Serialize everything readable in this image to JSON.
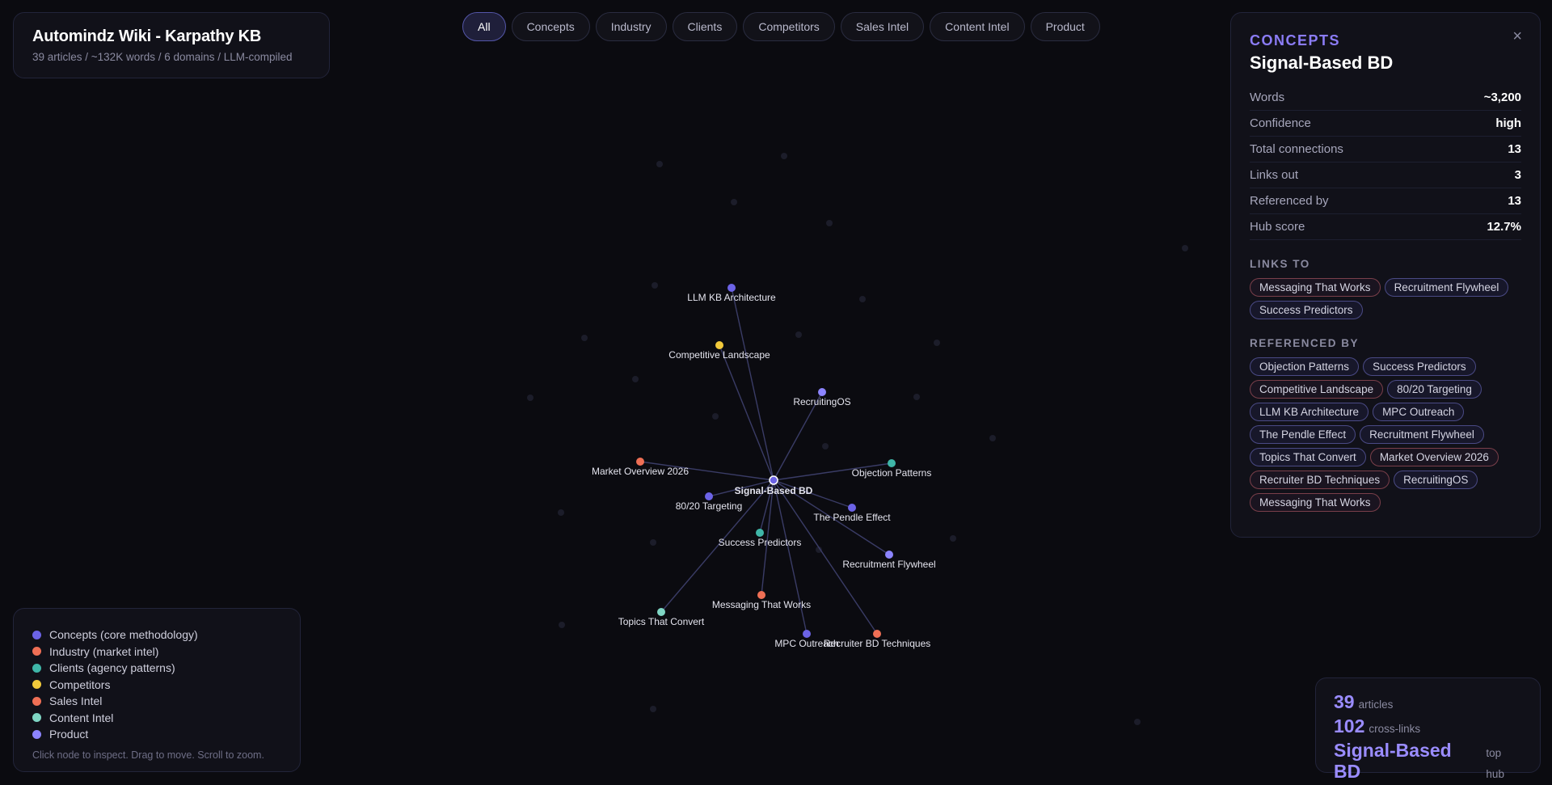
{
  "header": {
    "title": "Automindz Wiki - Karpathy KB",
    "subtitle": "39 articles / ~132K words / 6 domains / LLM-compiled"
  },
  "tabs": [
    {
      "label": "All",
      "active": true
    },
    {
      "label": "Concepts",
      "active": false
    },
    {
      "label": "Industry",
      "active": false
    },
    {
      "label": "Clients",
      "active": false
    },
    {
      "label": "Competitors",
      "active": false
    },
    {
      "label": "Sales Intel",
      "active": false
    },
    {
      "label": "Content Intel",
      "active": false
    },
    {
      "label": "Product",
      "active": false
    }
  ],
  "colors": {
    "concepts": "#6c63e6",
    "industry": "#ef6f55",
    "clients": "#3fb6a8",
    "competitors": "#f1c93b",
    "sales_intel": "#ef6f55",
    "content_intel": "#7fd6c4",
    "product": "#8c84ff",
    "edge": "#3a3c66",
    "faint_node": "#1c1d2a"
  },
  "graph": {
    "center": {
      "label": "Signal-Based BD",
      "category": "concepts"
    },
    "nodes": [
      {
        "label": "LLM KB Architecture",
        "category": "concepts"
      },
      {
        "label": "Competitive Landscape",
        "category": "competitors"
      },
      {
        "label": "RecruitingOS",
        "category": "product"
      },
      {
        "label": "Market Overview 2026",
        "category": "industry"
      },
      {
        "label": "Objection Patterns",
        "category": "clients"
      },
      {
        "label": "80/20 Targeting",
        "category": "concepts"
      },
      {
        "label": "The Pendle Effect",
        "category": "concepts"
      },
      {
        "label": "Success Predictors",
        "category": "clients"
      },
      {
        "label": "Recruitment Flywheel",
        "category": "product"
      },
      {
        "label": "Messaging That Works",
        "category": "sales_intel"
      },
      {
        "label": "Topics That Convert",
        "category": "content_intel"
      },
      {
        "label": "MPC Outreach",
        "category": "concepts"
      },
      {
        "label": "Recruiter BD Techniques",
        "category": "industry"
      }
    ]
  },
  "detail": {
    "close_icon": "×",
    "category": "CONCEPTS",
    "name": "Signal-Based BD",
    "stats": [
      {
        "label": "Words",
        "value": "~3,200"
      },
      {
        "label": "Confidence",
        "value": "high"
      },
      {
        "label": "Total connections",
        "value": "13"
      },
      {
        "label": "Links out",
        "value": "3"
      },
      {
        "label": "Referenced by",
        "value": "13"
      },
      {
        "label": "Hub score",
        "value": "12.7%"
      }
    ],
    "links_to_title": "LINKS TO",
    "links_to": [
      {
        "label": "Messaging That Works",
        "tone": "warm"
      },
      {
        "label": "Recruitment Flywheel",
        "tone": "cool"
      },
      {
        "label": "Success Predictors",
        "tone": "cool"
      }
    ],
    "referenced_by_title": "REFERENCED BY",
    "referenced_by": [
      {
        "label": "Objection Patterns",
        "tone": "cool"
      },
      {
        "label": "Success Predictors",
        "tone": "cool"
      },
      {
        "label": "Competitive Landscape",
        "tone": "warm"
      },
      {
        "label": "80/20 Targeting",
        "tone": "cool"
      },
      {
        "label": "LLM KB Architecture",
        "tone": "cool"
      },
      {
        "label": "MPC Outreach",
        "tone": "cool"
      },
      {
        "label": "The Pendle Effect",
        "tone": "cool"
      },
      {
        "label": "Recruitment Flywheel",
        "tone": "cool"
      },
      {
        "label": "Topics That Convert",
        "tone": "cool"
      },
      {
        "label": "Market Overview 2026",
        "tone": "warm"
      },
      {
        "label": "Recruiter BD Techniques",
        "tone": "warm"
      },
      {
        "label": "RecruitingOS",
        "tone": "cool"
      },
      {
        "label": "Messaging That Works",
        "tone": "warm"
      }
    ]
  },
  "legend": {
    "items": [
      {
        "label": "Concepts (core methodology)",
        "color": "#6c63e6"
      },
      {
        "label": "Industry (market intel)",
        "color": "#ef6f55"
      },
      {
        "label": "Clients (agency patterns)",
        "color": "#3fb6a8"
      },
      {
        "label": "Competitors",
        "color": "#f1c93b"
      },
      {
        "label": "Sales Intel",
        "color": "#ef6f55"
      },
      {
        "label": "Content Intel",
        "color": "#7fd6c4"
      },
      {
        "label": "Product",
        "color": "#8c84ff"
      }
    ],
    "hint": "Click node to inspect. Drag to move. Scroll to zoom."
  },
  "stats": {
    "articles_value": "39",
    "articles_label": "articles",
    "links_value": "102",
    "links_label": "cross-links",
    "hub_value": "Signal-Based BD",
    "hub_label": "top hub"
  }
}
